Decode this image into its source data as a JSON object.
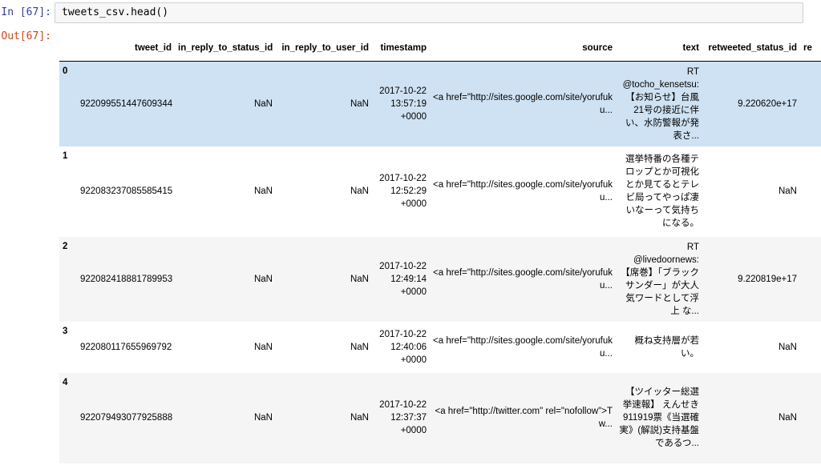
{
  "input": {
    "prompt": "In [67]:",
    "code": "tweets_csv.head()"
  },
  "output": {
    "prompt": "Out[67]:"
  },
  "table": {
    "columns": [
      "",
      "tweet_id",
      "in_reply_to_status_id",
      "in_reply_to_user_id",
      "timestamp",
      "source",
      "text",
      "retweeted_status_id",
      "re"
    ],
    "rows": [
      {
        "index": "0",
        "tweet_id": "922099551447609344",
        "in_reply_to_status_id": "NaN",
        "in_reply_to_user_id": "NaN",
        "timestamp": "2017-10-22 13:57:19 +0000",
        "source": "<a href=\"http://sites.google.com/site/yorufuku...",
        "text": "RT @tocho_kensetsu: 【お知らせ】台風21号の接近に伴い、水防警報が発表さ...",
        "retweeted_status_id": "9.220620e+17"
      },
      {
        "index": "1",
        "tweet_id": "922083237085585415",
        "in_reply_to_status_id": "NaN",
        "in_reply_to_user_id": "NaN",
        "timestamp": "2017-10-22 12:52:29 +0000",
        "source": "<a href=\"http://sites.google.com/site/yorufuku...",
        "text": "選挙特番の各種テロップとか可視化とか見てるとテレビ局ってやっぱ凄いなーって気持ちになる。",
        "retweeted_status_id": "NaN"
      },
      {
        "index": "2",
        "tweet_id": "922082418881789953",
        "in_reply_to_status_id": "NaN",
        "in_reply_to_user_id": "NaN",
        "timestamp": "2017-10-22 12:49:14 +0000",
        "source": "<a href=\"http://sites.google.com/site/yorufuku...",
        "text": "RT @livedoornews: 【席巻】「ブラックサンダー」が大人気ワードとして浮上 な...",
        "retweeted_status_id": "9.220819e+17"
      },
      {
        "index": "3",
        "tweet_id": "922080117655969792",
        "in_reply_to_status_id": "NaN",
        "in_reply_to_user_id": "NaN",
        "timestamp": "2017-10-22 12:40:06 +0000",
        "source": "<a href=\"http://sites.google.com/site/yorufuku...",
        "text": "概ね支持層が若い。",
        "retweeted_status_id": "NaN"
      },
      {
        "index": "4",
        "tweet_id": "922079493077925888",
        "in_reply_to_status_id": "NaN",
        "in_reply_to_user_id": "NaN",
        "timestamp": "2017-10-22 12:37:37 +0000",
        "source": "<a href=\"http://twitter.com\" rel=\"nofollow\">Tw...",
        "text": "【ツイッター総選挙速報】 えんせき 911919票《当選確実》(解説)支持基盤であるつ...",
        "retweeted_status_id": "NaN"
      }
    ]
  }
}
